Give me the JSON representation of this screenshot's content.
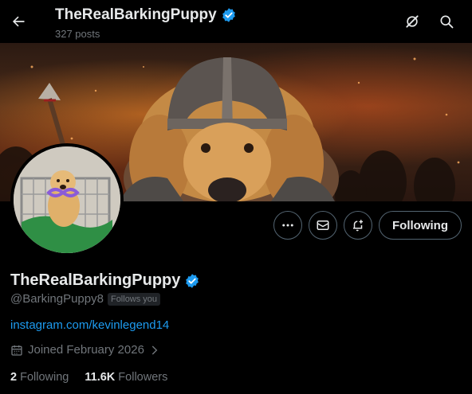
{
  "header": {
    "name": "TheRealBarkingPuppy",
    "posts": "327 posts"
  },
  "icons": {
    "back": "arrow-left-icon",
    "grok": "grok-icon",
    "search": "search-icon",
    "verified": "verified-badge-icon",
    "more": "more-icon",
    "message": "envelope-icon",
    "notify": "bell-plus-icon",
    "calendar": "calendar-icon",
    "chevron": "chevron-right-icon"
  },
  "actions": {
    "following_label": "Following"
  },
  "profile": {
    "display_name": "TheRealBarkingPuppy",
    "handle": "@BarkingPuppy8",
    "follows_you": "Follows you",
    "link": "instagram.com/kevinlegend14",
    "joined": "Joined February 2026"
  },
  "stats": {
    "following_count": "2",
    "following_label": "Following",
    "followers_count": "11.6K",
    "followers_label": "Followers"
  },
  "colors": {
    "accent": "#1d9bf0",
    "muted": "#71767b",
    "text": "#e7e9ea",
    "border": "#536471",
    "background": "#000000"
  }
}
